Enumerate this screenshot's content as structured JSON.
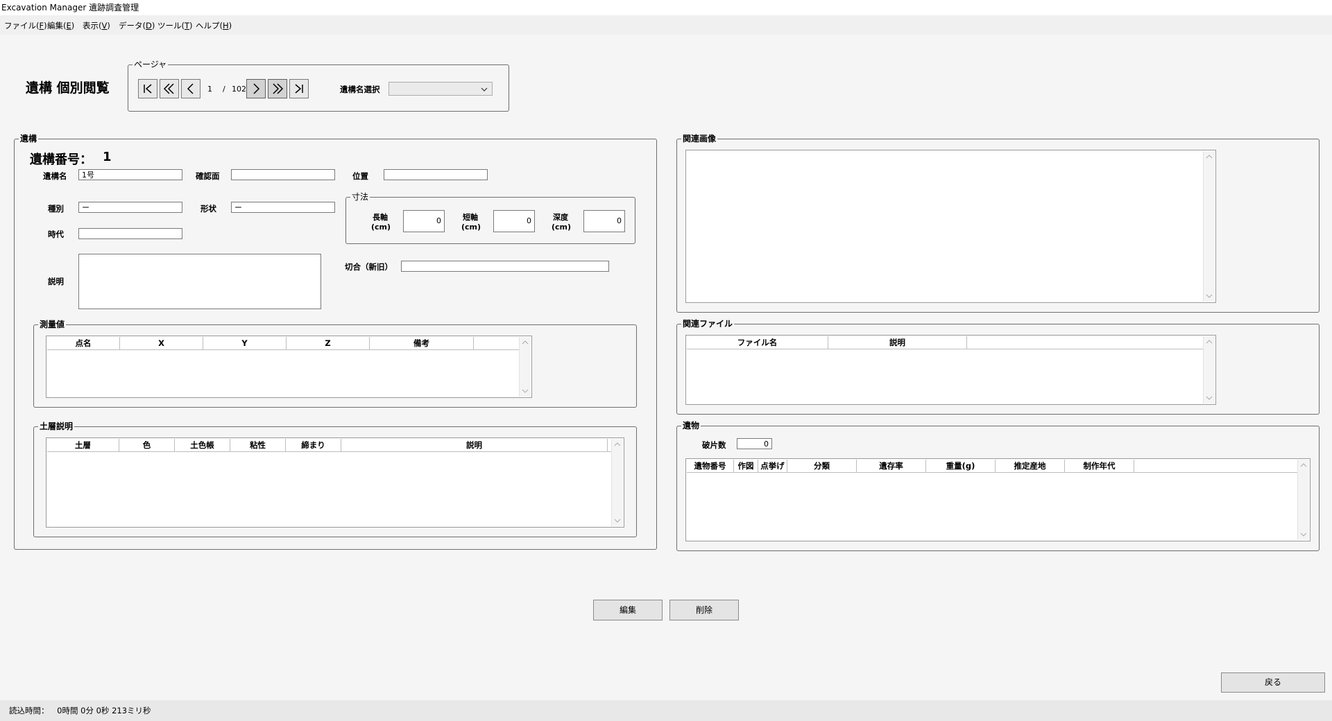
{
  "window": {
    "title": "Excavation Manager 遺跡調査管理"
  },
  "menu": [
    {
      "label": "ファイル(",
      "key": "F",
      "suffix": ")"
    },
    {
      "label": "編集(",
      "key": "E",
      "suffix": ")"
    },
    {
      "label": "表示(",
      "key": "V",
      "suffix": ")"
    },
    {
      "label": "データ(",
      "key": "D",
      "suffix": ")"
    },
    {
      "label": "ツール(",
      "key": "T",
      "suffix": ")"
    },
    {
      "label": "ヘルプ(",
      "key": "H",
      "suffix": ")"
    }
  ],
  "page_title": "遺構 個別閲覧",
  "pager": {
    "legend": "ページャ",
    "current": "1",
    "separator": "/",
    "total": "102",
    "select_label": "遺構名選択",
    "select_value": ""
  },
  "feature": {
    "legend": "遺構",
    "number_label": "遺構番号：",
    "number_value": "1",
    "name_label": "遺構名",
    "name_value": "1号",
    "surface_label": "確認面",
    "surface_value": "",
    "position_label": "位置",
    "position_value": "",
    "type_label": "種別",
    "type_value": "ー",
    "shape_label": "形状",
    "shape_value": "ー",
    "era_label": "時代",
    "era_value": "",
    "desc_label": "説明",
    "desc_value": "",
    "cut_label": "切合（新旧）",
    "cut_value": "",
    "dims": {
      "legend": "寸法",
      "long_label_1": "長軸",
      "long_label_2": "(cm)",
      "long_value": "0",
      "short_label_1": "短軸",
      "short_label_2": "(cm)",
      "short_value": "0",
      "depth_label_1": "深度",
      "depth_label_2": "(cm)",
      "depth_value": "0"
    }
  },
  "survey": {
    "legend": "測量値",
    "columns": [
      "点名",
      "X",
      "Y",
      "Z",
      "備考"
    ],
    "rows": []
  },
  "strata": {
    "legend": "土層説明",
    "columns": [
      "土層",
      "色",
      "土色帳",
      "粘性",
      "締まり",
      "説明"
    ],
    "rows": []
  },
  "images": {
    "legend": "関連画像"
  },
  "files": {
    "legend": "関連ファイル",
    "columns": [
      "ファイル名",
      "説明"
    ],
    "rows": []
  },
  "artifacts": {
    "legend": "遺物",
    "fragments_label": "破片数",
    "fragments_value": "0",
    "columns": [
      "遺物番号",
      "作図",
      "点挙げ",
      "分類",
      "遺存率",
      "重量(g)",
      "推定産地",
      "制作年代"
    ],
    "rows": []
  },
  "actions": {
    "edit": "編集",
    "delete": "削除",
    "back": "戻る"
  },
  "status": {
    "load_label": "読込時間：",
    "load_value": "0時間 0分 0秒 213ミリ秒"
  }
}
